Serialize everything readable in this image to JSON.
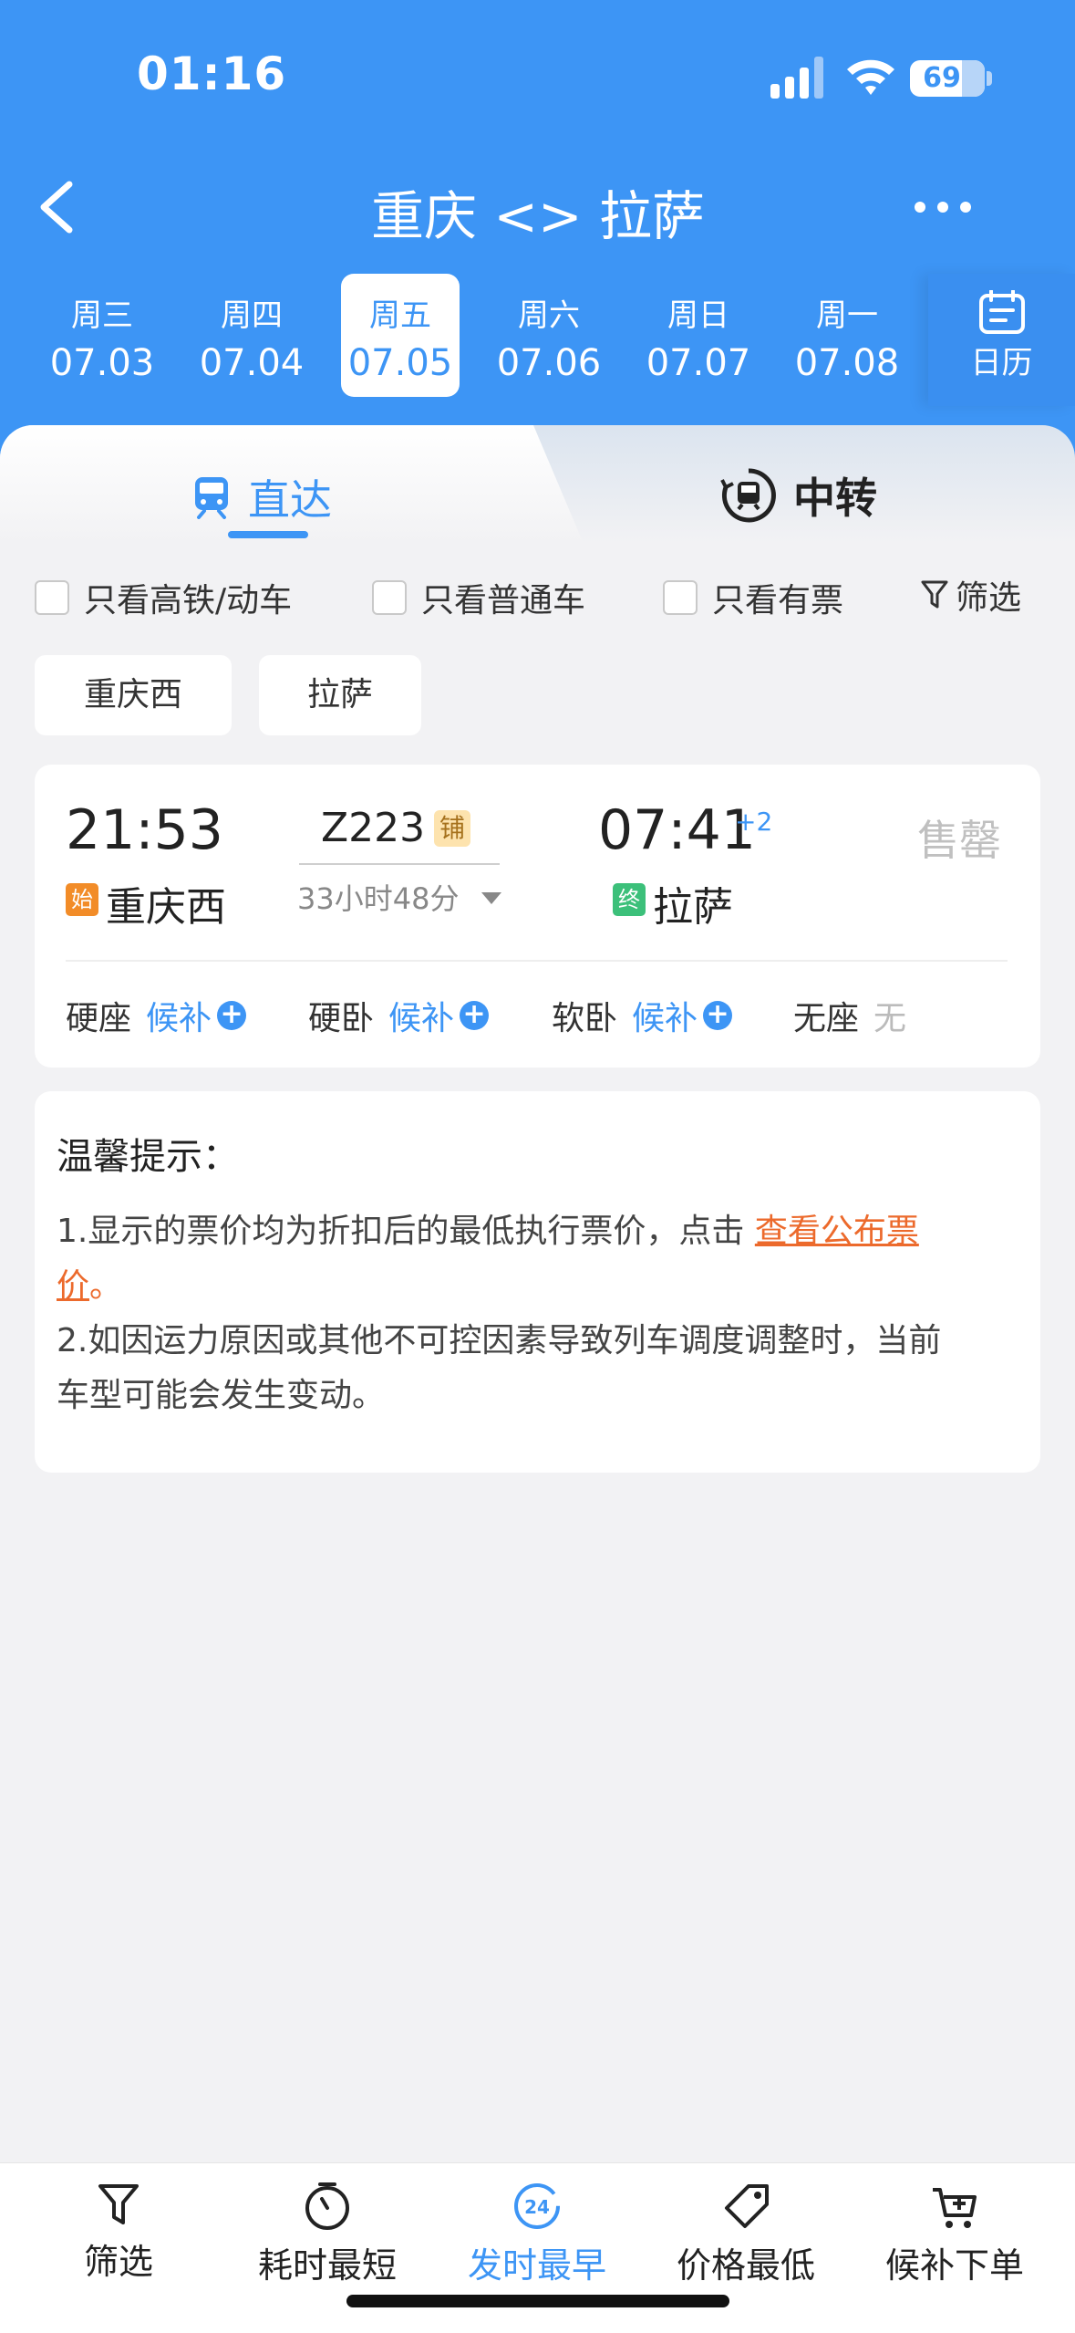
{
  "status_bar": {
    "time": "01:16",
    "battery": "69",
    "battery_level": 0.69
  },
  "nav": {
    "title": "重庆 <> 拉萨"
  },
  "dates": [
    {
      "weekday": "周三",
      "date": "07.03"
    },
    {
      "weekday": "周四",
      "date": "07.04"
    },
    {
      "weekday": "周五",
      "date": "07.05",
      "active": true
    },
    {
      "weekday": "周六",
      "date": "07.06"
    },
    {
      "weekday": "周日",
      "date": "07.07"
    },
    {
      "weekday": "周一",
      "date": "07.08"
    }
  ],
  "calendar_label": "日历",
  "tabs": {
    "direct": "直达",
    "transfer": "中转"
  },
  "filters": {
    "high_speed": "只看高铁/动车",
    "normal": "只看普通车",
    "available": "只看有票",
    "filter": "筛选"
  },
  "stations": {
    "from": "重庆西",
    "to": "拉萨"
  },
  "train": {
    "dep_time": "21:53",
    "arr_time": "07:41",
    "arr_plus": "+2",
    "number": "Z223",
    "sleeper_tag": "铺",
    "duration": "33小时48分",
    "from_tag": "始",
    "from": "重庆西",
    "to_tag": "终",
    "to": "拉萨",
    "status": "售罄",
    "seats": [
      {
        "type": "硬座",
        "status": "候补"
      },
      {
        "type": "硬卧",
        "status": "候补"
      },
      {
        "type": "软卧",
        "status": "候补"
      },
      {
        "type": "无座",
        "status": "无"
      }
    ]
  },
  "tips": {
    "title": "温馨提示：",
    "line1_a": "1.显示的票价均为折扣后的最低执行票价，点击",
    "line1_link_a": "查看公布票",
    "line1_link_b": "价",
    "line1_end": "。",
    "line2_a": "2.如因运力原因或其他不可控因素导致列车调度调整时，当前",
    "line2_b": "车型可能会发生变动。"
  },
  "bottom_bar": [
    {
      "label": "筛选",
      "icon": "filter-icon"
    },
    {
      "label": "耗时最短",
      "icon": "timer-icon"
    },
    {
      "label": "发时最早",
      "icon": "clock-24-icon",
      "active": true
    },
    {
      "label": "价格最低",
      "icon": "price-tag-icon"
    },
    {
      "label": "候补下单",
      "icon": "cart-add-icon"
    }
  ],
  "colors": {
    "primary": "#3d95f5",
    "link": "#ec6a2c",
    "from_tag": "#f28c28",
    "to_tag": "#3cc07a"
  }
}
